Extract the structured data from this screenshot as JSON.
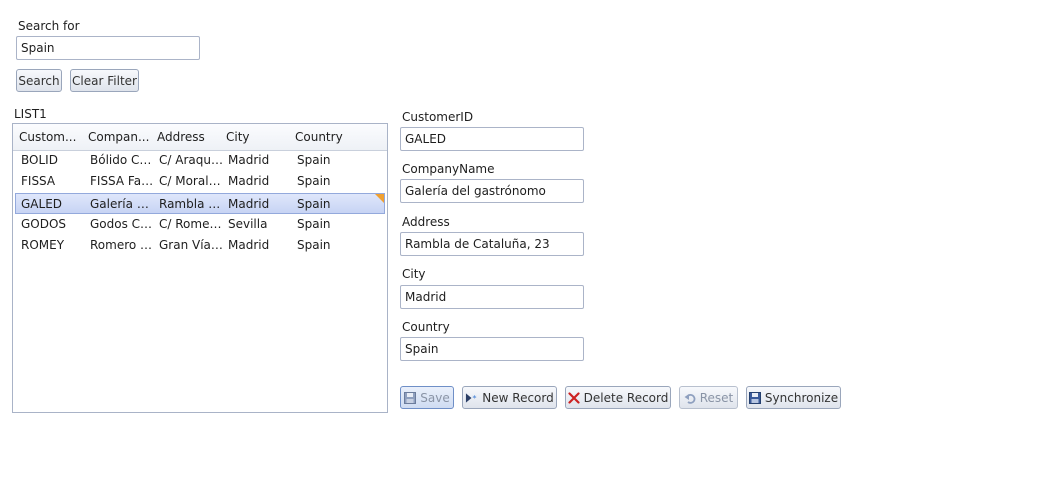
{
  "search": {
    "label": "Search for",
    "value": "Spain",
    "search_button": "Search",
    "clear_button": "Clear Filter"
  },
  "list": {
    "title": "LIST1",
    "columns": [
      "Custom...",
      "Compan...",
      "Address",
      "City",
      "Country"
    ],
    "rows": [
      [
        "BOLID",
        "Bólido Co...",
        "C/ Araquil,...",
        "Madrid",
        "Spain"
      ],
      [
        "FISSA",
        "FISSA Fabri...",
        "C/ Moralza...",
        "Madrid",
        "Spain"
      ],
      [
        "GALED",
        "Galería del...",
        "Rambla de...",
        "Madrid",
        "Spain"
      ],
      [
        "GODOS",
        "Godos Coc...",
        "C/ Romero...",
        "Sevilla",
        "Spain"
      ],
      [
        "ROMEY",
        "Romero y t...",
        "Gran Vía, 1",
        "Madrid",
        "Spain"
      ]
    ],
    "selected_index": 2
  },
  "form": {
    "fields": [
      {
        "label": "CustomerID",
        "value": "GALED"
      },
      {
        "label": "CompanyName",
        "value": "Galería del gastrónomo"
      },
      {
        "label": "Address",
        "value": "Rambla de Cataluña, 23"
      },
      {
        "label": "City",
        "value": "Madrid"
      },
      {
        "label": "Country",
        "value": "Spain"
      }
    ]
  },
  "toolbar": {
    "save": "Save",
    "new_record": "New Record",
    "delete_record": "Delete Record",
    "reset": "Reset",
    "synchronize": "Synchronize"
  },
  "colors": {
    "accent": "#c7d4f4",
    "border": "#abb4c8",
    "delete_icon": "#cc2222",
    "save_icon": "#3a5a9a",
    "change_marker": "#f0a030"
  },
  "icons": {
    "save": "floppy-icon",
    "new_record": "new-record-icon",
    "delete_record": "delete-x-icon",
    "reset": "undo-icon",
    "synchronize": "sync-floppy-icon"
  }
}
